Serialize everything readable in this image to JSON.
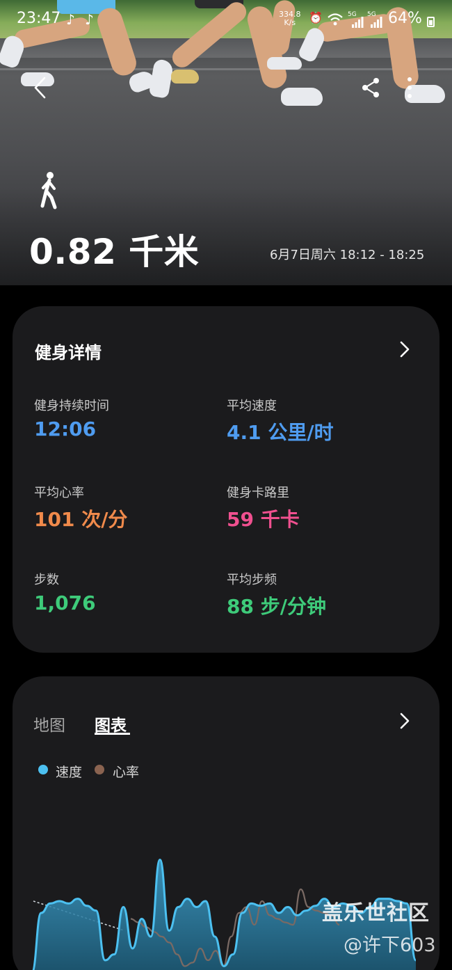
{
  "status_bar": {
    "time": "23:47",
    "net_speed_value": "334.8",
    "net_speed_unit": "K/s",
    "battery": "64%",
    "signal_1": "5G",
    "signal_2": "5G"
  },
  "hero": {
    "distance": "0.82 千米",
    "datetime": "6月7日周六 18:12 - 18:25",
    "activity_icon": "walking-person-icon"
  },
  "details": {
    "title": "健身详情",
    "stats": [
      {
        "label": "健身持续时间",
        "value": "12:06",
        "color": "#4f9cf0"
      },
      {
        "label": "平均速度",
        "value": "4.1 公里/时",
        "color": "#4f9cf0"
      },
      {
        "label": "平均心率",
        "value": "101 次/分",
        "color": "#f08a4b"
      },
      {
        "label": "健身卡路里",
        "value": "59 千卡",
        "color": "#f0508f"
      },
      {
        "label": "步数",
        "value": "1,076",
        "color": "#3ecb7a"
      },
      {
        "label": "平均步频",
        "value": "88 步/分钟",
        "color": "#3ecb7a"
      }
    ]
  },
  "chart_card": {
    "tabs": [
      "地图",
      "图表"
    ],
    "active_tab": "图表",
    "legend": [
      {
        "name": "速度",
        "color": "#4cc0f0"
      },
      {
        "name": "心率",
        "color": "#8a6350"
      }
    ]
  },
  "chart_data": {
    "type": "area",
    "series": [
      {
        "name": "速度",
        "color": "#4cc0f0",
        "values": [
          0,
          0.5,
          0.58,
          0.6,
          0.58,
          0.62,
          0.56,
          0.52,
          0.1,
          0.15,
          0.55,
          0.2,
          0.45,
          0.3,
          0.95,
          0.35,
          0.55,
          0.62,
          0.55,
          0.6,
          0.3,
          0.05,
          0.15,
          0.5,
          0.58,
          0.56,
          0.58,
          0.5,
          0.55,
          0.48,
          0.52,
          0.56,
          0.62,
          0.55,
          0.58,
          0.56,
          0.5,
          0.55,
          0.62,
          0.62,
          0.6,
          0.58,
          0.1
        ]
      },
      {
        "name": "心率",
        "color": "#7a6a64",
        "values": [
          0.45,
          0.42,
          0.38,
          0.34,
          0.3,
          0.25,
          0.15,
          0.05,
          0.08,
          0.2,
          0.1,
          0.18,
          0.05,
          0.3,
          0.5,
          0.55,
          0.4,
          0.6,
          0.48,
          0.45,
          0.42,
          0.4,
          0.7,
          0.55,
          0.52,
          0.5,
          0.48,
          0.4
        ]
      }
    ]
  },
  "watermark": {
    "site": "盖乐世社区",
    "user": "@许下603"
  }
}
